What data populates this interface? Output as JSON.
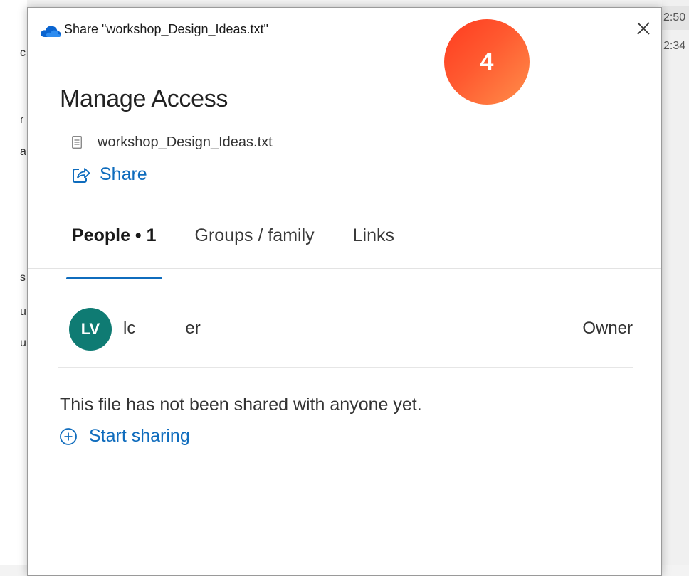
{
  "background": {
    "left_fragments": [
      "c",
      "r",
      "a",
      "s",
      "u",
      "u"
    ],
    "right_times": [
      "2:50",
      "2:34"
    ]
  },
  "dialog": {
    "title": "Share \"workshop_Design_Ideas.txt\"",
    "close_symbol": "✕",
    "step_badge": "4",
    "heading": "Manage Access",
    "file_name": "workshop_Design_Ideas.txt",
    "share_label": "Share",
    "tabs": [
      {
        "label": "People • 1",
        "active": true
      },
      {
        "label": "Groups / family",
        "active": false
      },
      {
        "label": "Links",
        "active": false
      }
    ],
    "people": [
      {
        "initials": "LV",
        "name_start": "lc",
        "name_end": "er",
        "role": "Owner"
      }
    ],
    "empty_message": "This file has not been shared with anyone yet.",
    "start_sharing_label": "Start sharing"
  },
  "colors": {
    "accent": "#0f6cbd",
    "avatar": "#0f7b73",
    "badge_start": "#ff3b1f",
    "badge_end": "#ff8e4a"
  },
  "icons": {
    "app": "onedrive-cloud-icon",
    "file": "text-document-icon",
    "share": "share-arrow-icon",
    "add": "circle-plus-icon",
    "close": "close-icon"
  }
}
